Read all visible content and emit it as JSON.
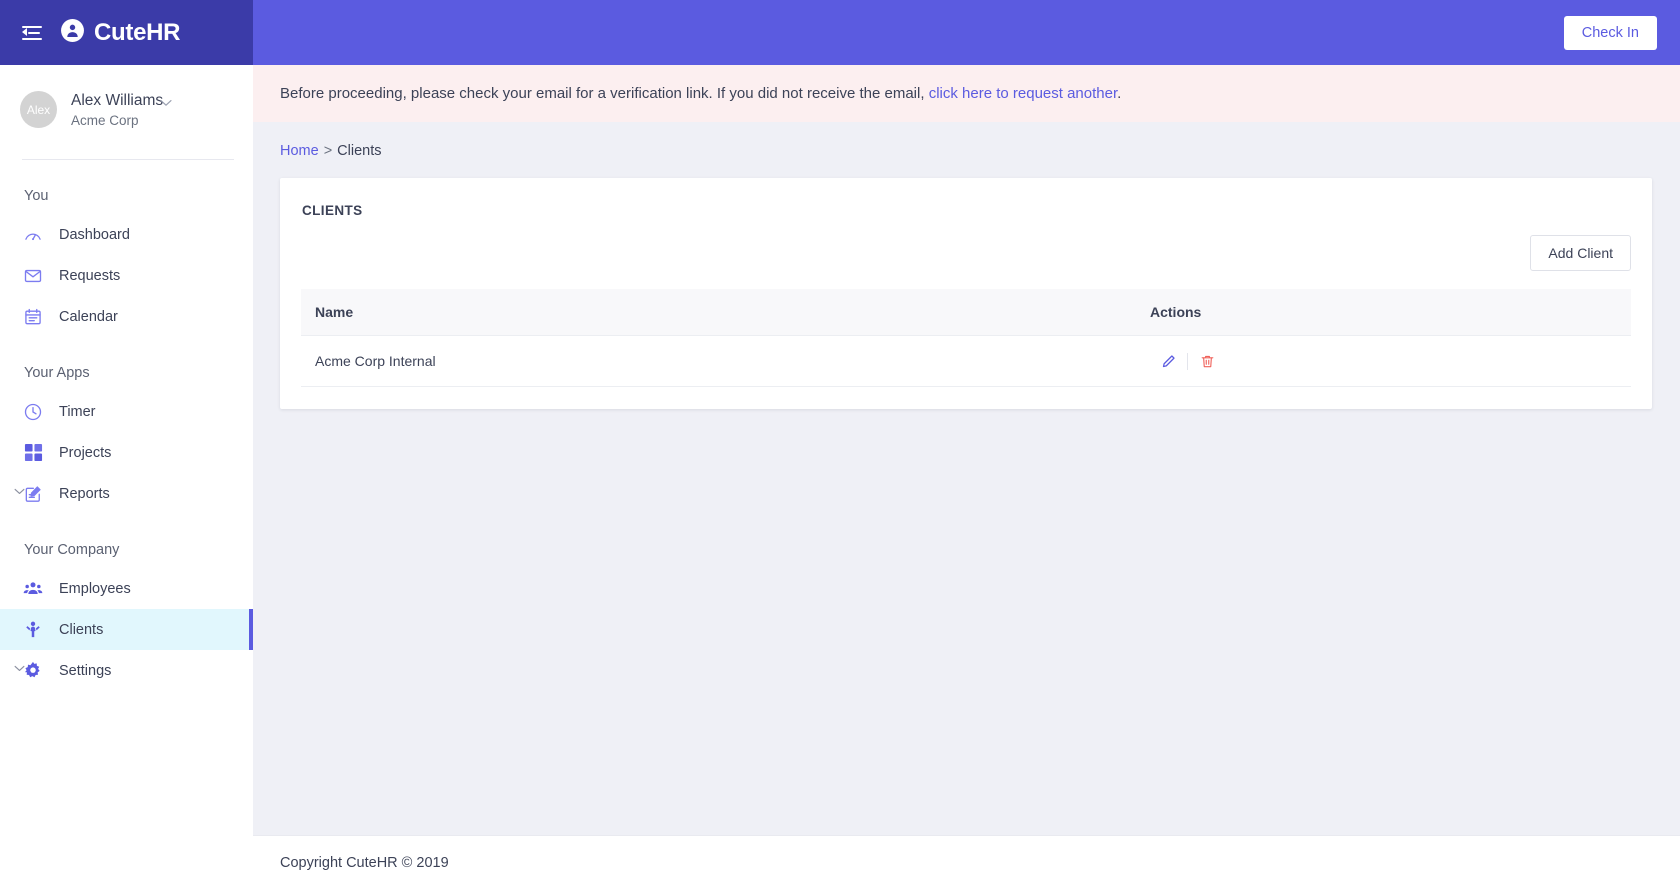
{
  "brand": {
    "name": "CuteHR",
    "logo_icon": "person-circle-icon",
    "menu_icon": "hamburger-collapse-icon",
    "bar_color": "#3b3ba8"
  },
  "topbar": {
    "checkin_label": "Check In",
    "bg_color": "#5b5be0"
  },
  "user": {
    "avatar_initials": "Alex",
    "name": "Alex Williams",
    "organization": "Acme Corp",
    "chevron_icon": "chevron-down-icon"
  },
  "sidebar": {
    "sections": [
      {
        "label": "You",
        "items": [
          {
            "label": "Dashboard",
            "icon": "dashboard-gauge-icon",
            "active": false,
            "caret": false
          },
          {
            "label": "Requests",
            "icon": "envelope-icon",
            "active": false,
            "caret": false
          },
          {
            "label": "Calendar",
            "icon": "calendar-icon",
            "active": false,
            "caret": false
          }
        ]
      },
      {
        "label": "Your Apps",
        "items": [
          {
            "label": "Timer",
            "icon": "clock-icon",
            "active": false,
            "caret": false
          },
          {
            "label": "Projects",
            "icon": "grid-squares-icon",
            "active": false,
            "caret": false
          },
          {
            "label": "Reports",
            "icon": "report-edit-icon",
            "active": false,
            "caret": true
          }
        ]
      },
      {
        "label": "Your Company",
        "items": [
          {
            "label": "Employees",
            "icon": "people-group-icon",
            "active": false,
            "caret": false
          },
          {
            "label": "Clients",
            "icon": "person-raised-arms-icon",
            "active": true,
            "caret": false
          },
          {
            "label": "Settings",
            "icon": "gear-icon",
            "active": false,
            "caret": true
          }
        ]
      }
    ],
    "active_bg_color": "#e1f7fd",
    "active_indicator_color": "#5b5be0"
  },
  "alert": {
    "text_before": "Before proceeding, please check your email for a verification link. If you did not receive the email,",
    "link_text": "click here to request another",
    "text_after": ".",
    "bg_color": "#fceff0",
    "link_color": "#5b5be0"
  },
  "breadcrumb": {
    "home_label": "Home",
    "separator": ">",
    "current_label": "Clients"
  },
  "card": {
    "title": "CLIENTS",
    "add_button_label": "Add Client"
  },
  "table": {
    "columns": [
      "Name",
      "Actions"
    ],
    "rows": [
      {
        "name": "Acme Corp Internal",
        "actions": [
          {
            "icon": "edit-pencil-icon",
            "color": "#5b5be0"
          },
          {
            "icon": "trash-delete-icon",
            "color": "#f0625b"
          }
        ]
      }
    ]
  },
  "footer": {
    "copyright": "Copyright CuteHR © 2019"
  }
}
